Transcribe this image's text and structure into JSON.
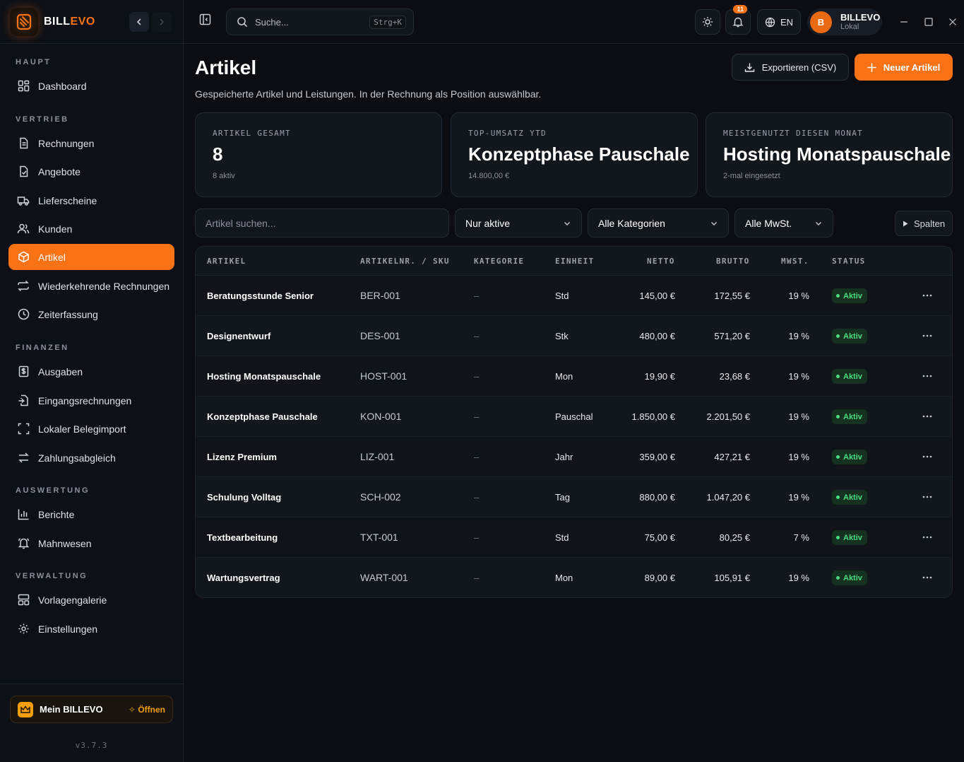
{
  "brand": {
    "name_a": "BILL",
    "name_b": "EVO"
  },
  "sidebar": {
    "sections": [
      {
        "label": "HAUPT"
      },
      {
        "label": "VERTRIEB"
      },
      {
        "label": "FINANZEN"
      },
      {
        "label": "AUSWERTUNG"
      },
      {
        "label": "VERWALTUNG"
      }
    ],
    "items": [
      {
        "label": "Dashboard",
        "icon": "dashboard-icon"
      },
      {
        "label": "Rechnungen",
        "icon": "document-icon"
      },
      {
        "label": "Angebote",
        "icon": "check-document-icon"
      },
      {
        "label": "Lieferscheine",
        "icon": "truck-icon"
      },
      {
        "label": "Kunden",
        "icon": "users-icon"
      },
      {
        "label": "Artikel",
        "icon": "package-icon",
        "active": true
      },
      {
        "label": "Wiederkehrende Rechnungen",
        "icon": "repeat-icon"
      },
      {
        "label": "Zeiterfassung",
        "icon": "clock-icon"
      },
      {
        "label": "Ausgaben",
        "icon": "dollar-document-icon"
      },
      {
        "label": "Eingangsrechnungen",
        "icon": "inbox-document-icon"
      },
      {
        "label": "Lokaler Belegimport",
        "icon": "scan-icon"
      },
      {
        "label": "Zahlungsabgleich",
        "icon": "swap-icon"
      },
      {
        "label": "Berichte",
        "icon": "bar-chart-icon"
      },
      {
        "label": "Mahnwesen",
        "icon": "bell-icon"
      },
      {
        "label": "Vorlagengalerie",
        "icon": "layout-icon"
      },
      {
        "label": "Einstellungen",
        "icon": "gear-icon"
      }
    ],
    "footer": {
      "mein": "Mein BILLEVO",
      "open": "Öffnen",
      "version": "v3.7.3"
    }
  },
  "topbar": {
    "search_placeholder": "Suche...",
    "shortcut": "Strg+K",
    "notifications": "11",
    "language": "EN",
    "user": {
      "initial": "B",
      "name": "BILLEVO",
      "sub": "Lokal"
    }
  },
  "page": {
    "title": "Artikel",
    "subtitle": "Gespeicherte Artikel und Leistungen. In der Rechnung als Position auswählbar.",
    "export_label": "Exportieren (CSV)",
    "new_label": "Neuer Artikel"
  },
  "cards": [
    {
      "label": "ARTIKEL GESAMT",
      "value": "8",
      "sub": "8 aktiv"
    },
    {
      "label": "TOP-UMSATZ YTD",
      "value": "Konzeptphase Pauschale",
      "sub": "14.800,00 €"
    },
    {
      "label": "MEISTGENUTZT DIESEN MONAT",
      "value": "Hosting Monatspauschale",
      "sub": "2-mal eingesetzt"
    }
  ],
  "filters": {
    "search_placeholder": "Artikel suchen...",
    "status": "Nur aktive",
    "category": "Alle Kategorien",
    "vat": "Alle MwSt.",
    "columns": "Spalten"
  },
  "table": {
    "headers": [
      "ARTIKEL",
      "ARTIKELNR. / SKU",
      "KATEGORIE",
      "EINHEIT",
      "NETTO",
      "BRUTTO",
      "MWST.",
      "STATUS"
    ],
    "rows": [
      {
        "name": "Beratungsstunde Senior",
        "sku": "BER-001",
        "category": "–",
        "unit": "Std",
        "net": "145,00 €",
        "gross": "172,55 €",
        "vat": "19 %",
        "status": "Aktiv"
      },
      {
        "name": "Designentwurf",
        "sku": "DES-001",
        "category": "–",
        "unit": "Stk",
        "net": "480,00 €",
        "gross": "571,20 €",
        "vat": "19 %",
        "status": "Aktiv"
      },
      {
        "name": "Hosting Monatspauschale",
        "sku": "HOST-001",
        "category": "–",
        "unit": "Mon",
        "net": "19,90 €",
        "gross": "23,68 €",
        "vat": "19 %",
        "status": "Aktiv"
      },
      {
        "name": "Konzeptphase Pauschale",
        "sku": "KON-001",
        "category": "–",
        "unit": "Pauschal",
        "net": "1.850,00 €",
        "gross": "2.201,50 €",
        "vat": "19 %",
        "status": "Aktiv"
      },
      {
        "name": "Lizenz Premium",
        "sku": "LIZ-001",
        "category": "–",
        "unit": "Jahr",
        "net": "359,00 €",
        "gross": "427,21 €",
        "vat": "19 %",
        "status": "Aktiv"
      },
      {
        "name": "Schulung Volltag",
        "sku": "SCH-002",
        "category": "–",
        "unit": "Tag",
        "net": "880,00 €",
        "gross": "1.047,20 €",
        "vat": "19 %",
        "status": "Aktiv"
      },
      {
        "name": "Textbearbeitung",
        "sku": "TXT-001",
        "category": "–",
        "unit": "Std",
        "net": "75,00 €",
        "gross": "80,25 €",
        "vat": "7 %",
        "status": "Aktiv"
      },
      {
        "name": "Wartungsvertrag",
        "sku": "WART-001",
        "category": "–",
        "unit": "Mon",
        "net": "89,00 €",
        "gross": "105,91 €",
        "vat": "19 %",
        "status": "Aktiv"
      }
    ]
  },
  "colors": {
    "accent": "#f97316",
    "background": "#0b0d12",
    "surface": "#12161d",
    "success": "#4ade80"
  }
}
